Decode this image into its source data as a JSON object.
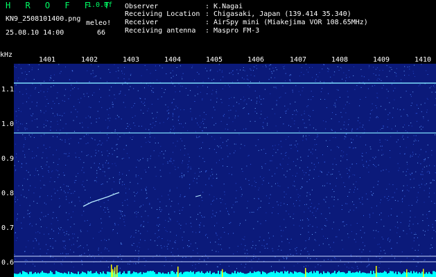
{
  "header": {
    "app_title": "H R O F F T",
    "version": "1.0.0f",
    "filename": "KN9_2508101400.png",
    "meleo_label": "meleo!",
    "datetime": "25.08.10 14:00",
    "meleo_count": "66"
  },
  "info": [
    {
      "key": "Observer",
      "value": ": K.Nagai"
    },
    {
      "key": "Receiving Location",
      "value": ": Chigasaki, Japan (139.414 35.340)"
    },
    {
      "key": "Receiver",
      "value": ": AirSpy mini (Miakejima VOR 108.65MHz)"
    },
    {
      "key": "Receiving antenna",
      "value": ": Maspro FM-3"
    }
  ],
  "axis": {
    "y_unit": "kHz",
    "x_ticks": [
      "1401",
      "1402",
      "1403",
      "1404",
      "1405",
      "1406",
      "1407",
      "1408",
      "1409",
      "1410"
    ],
    "y_ticks": [
      "1.1",
      "1.0",
      "0.9",
      "0.8",
      "0.7",
      "0.6"
    ]
  },
  "colors": {
    "background": "#0b1a7a",
    "signal": "#4fd4ff",
    "title_green": "#00ff66",
    "bottom_bar": "#00ffff",
    "peak_yellow": "#ffff00"
  }
}
